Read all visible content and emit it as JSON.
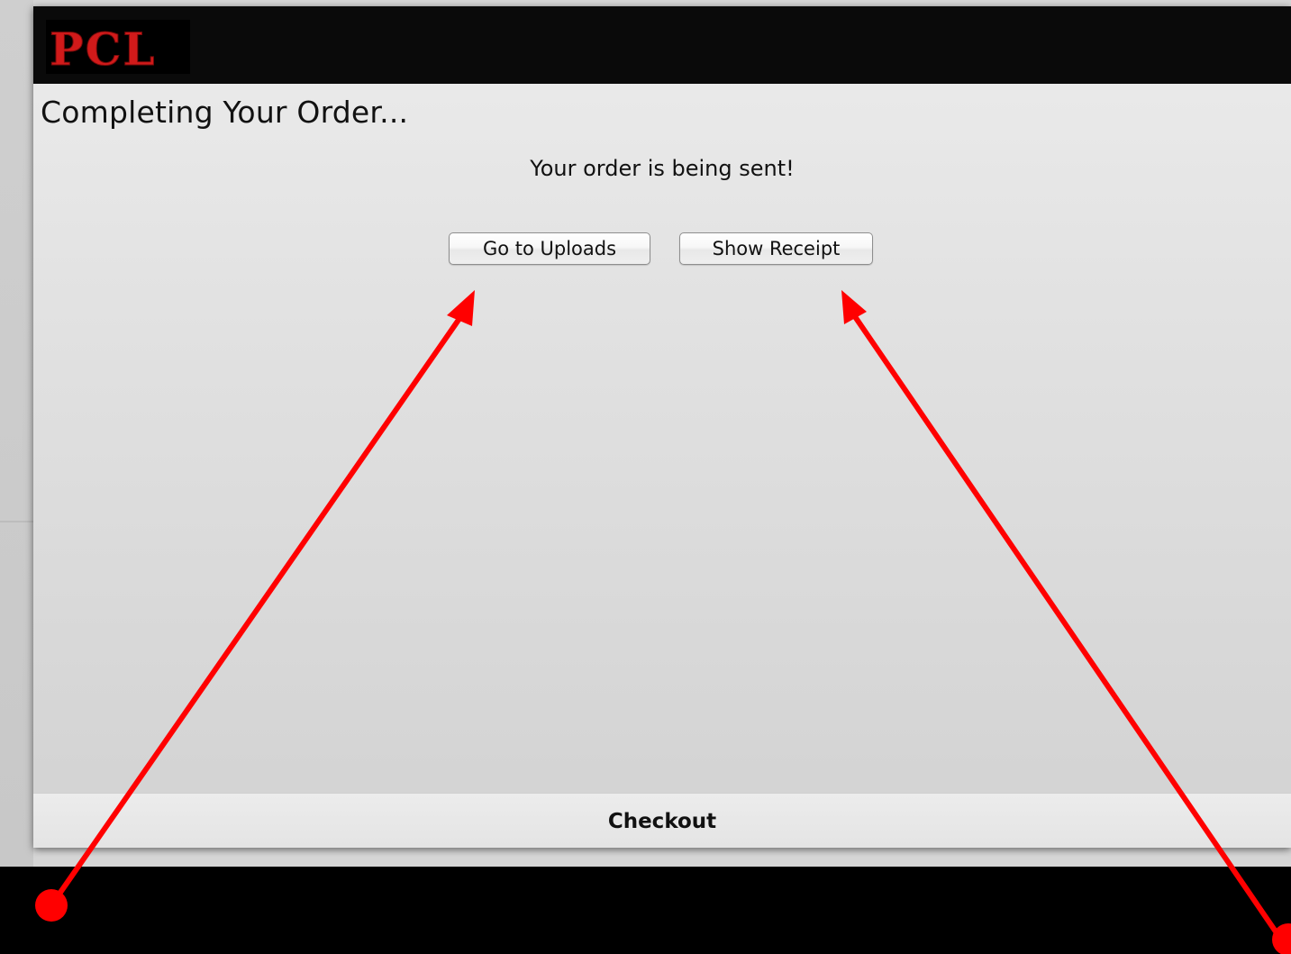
{
  "header": {
    "logo_text": "PCL"
  },
  "main": {
    "title": "Completing Your Order...",
    "status_message": "Your order is being sent!",
    "buttons": {
      "go_to_uploads": "Go to Uploads",
      "show_receipt": "Show Receipt"
    }
  },
  "footer": {
    "tab_label": "Checkout"
  },
  "annotations": {
    "arrow_color": "#ff0000",
    "arrows": [
      {
        "points_to": "Go to Uploads"
      },
      {
        "points_to": "Show Receipt"
      }
    ]
  },
  "colors": {
    "header_bg": "#0a0a0a",
    "logo_red": "#d11a1a",
    "window_bg": "#e2e2e2"
  }
}
